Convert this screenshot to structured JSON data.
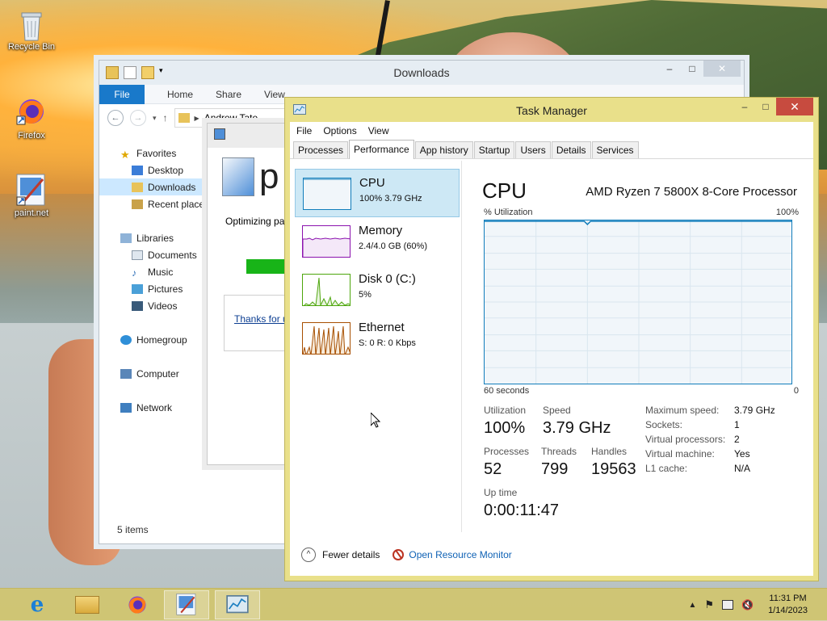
{
  "desktop": {
    "icons": [
      {
        "label": "Recycle Bin"
      },
      {
        "label": "Firefox"
      },
      {
        "label": "paint.net"
      }
    ]
  },
  "explorer": {
    "title": "Downloads",
    "ribbon": {
      "file": "File",
      "home": "Home",
      "share": "Share",
      "view": "View"
    },
    "address": "Andrew Tate",
    "nav": {
      "favorites": "Favorites",
      "desktop": "Desktop",
      "downloads": "Downloads",
      "recent": "Recent places",
      "libraries": "Libraries",
      "documents": "Documents",
      "music": "Music",
      "pictures": "Pictures",
      "videos": "Videos",
      "homegroup": "Homegroup",
      "computer": "Computer",
      "network": "Network"
    },
    "status": "5 items"
  },
  "paintdialog": {
    "logo_text": "p",
    "message": "Optimizing pa",
    "link": "Thanks for us"
  },
  "taskmanager": {
    "title": "Task Manager",
    "menu": {
      "file": "File",
      "options": "Options",
      "view": "View"
    },
    "tabs": [
      "Processes",
      "Performance",
      "App history",
      "Startup",
      "Users",
      "Details",
      "Services"
    ],
    "active_tab": "Performance",
    "resources": [
      {
        "name": "CPU",
        "value": "100% 3.79 GHz"
      },
      {
        "name": "Memory",
        "value": "2.4/4.0 GB (60%)"
      },
      {
        "name": "Disk 0 (C:)",
        "value": "5%"
      },
      {
        "name": "Ethernet",
        "value": "S: 0 R: 0 Kbps"
      }
    ],
    "detail": {
      "title": "CPU",
      "processor": "AMD Ryzen 7 5800X 8-Core Processor",
      "util_label": "% Utilization",
      "util_max": "100%",
      "time_label": "60 seconds",
      "time_end": "0",
      "utilization_label": "Utilization",
      "utilization": "100%",
      "speed_label": "Speed",
      "speed": "3.79 GHz",
      "processes_label": "Processes",
      "processes": "52",
      "threads_label": "Threads",
      "threads": "799",
      "handles_label": "Handles",
      "handles": "19563",
      "uptime_label": "Up time",
      "uptime": "0:00:11:47",
      "kv": [
        {
          "k": "Maximum speed:",
          "v": "3.79 GHz"
        },
        {
          "k": "Sockets:",
          "v": "1"
        },
        {
          "k": "Virtual processors:",
          "v": "2"
        },
        {
          "k": "Virtual machine:",
          "v": "Yes"
        },
        {
          "k": "L1 cache:",
          "v": "N/A"
        }
      ]
    },
    "footer": {
      "fewer": "Fewer details",
      "resource_monitor": "Open Resource Monitor"
    }
  },
  "taskbar": {
    "time": "11:31 PM",
    "date": "1/14/2023"
  },
  "colors": {
    "cpu_line": "#117dbb",
    "memory_line": "#8b12ae",
    "disk_line": "#4da60c",
    "ethernet_line": "#a74f01",
    "taskbar": "#d0c66e",
    "tm_frame": "#e9e08a"
  }
}
